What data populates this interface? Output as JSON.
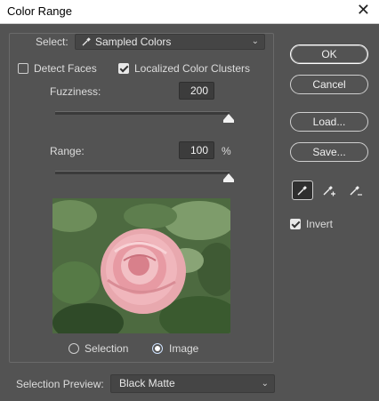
{
  "window": {
    "title": "Color Range",
    "close_glyph": "✕"
  },
  "select": {
    "label": "Select:",
    "value": "Sampled Colors"
  },
  "detect_faces": {
    "label": "Detect Faces",
    "checked": false
  },
  "localized_clusters": {
    "label": "Localized Color Clusters",
    "checked": true
  },
  "fuzziness": {
    "label": "Fuzziness:",
    "value": "200"
  },
  "range": {
    "label": "Range:",
    "value": "100",
    "unit": "%"
  },
  "preview_mode": {
    "selection_label": "Selection",
    "image_label": "Image",
    "selected": "Image"
  },
  "selection_preview": {
    "label": "Selection Preview:",
    "value": "Black Matte"
  },
  "buttons": {
    "ok": "OK",
    "cancel": "Cancel",
    "load": "Load...",
    "save": "Save..."
  },
  "tools": [
    "eyedropper-icon",
    "eyedropper-plus-icon",
    "eyedropper-minus-icon"
  ],
  "invert": {
    "label": "Invert",
    "checked": true
  }
}
